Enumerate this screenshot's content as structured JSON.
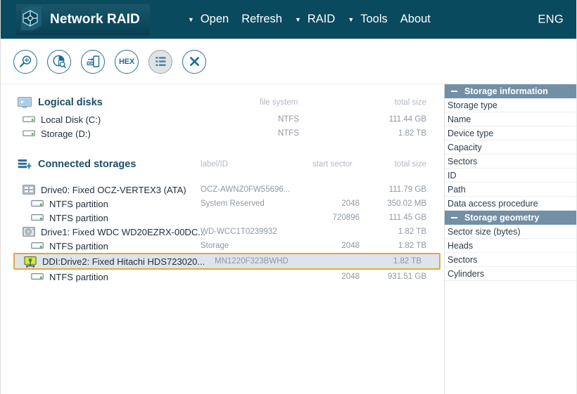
{
  "window": {
    "brand_title": "Network RAID",
    "logo_icon": "network-raid-hex-logo-icon",
    "language": "ENG"
  },
  "menu": {
    "items": [
      {
        "label": "Open",
        "caret": true,
        "caret_glyph": "▼"
      },
      {
        "label": "Refresh",
        "caret": false,
        "caret_glyph": ""
      },
      {
        "label": "RAID",
        "caret": true,
        "caret_glyph": "▼"
      },
      {
        "label": "Tools",
        "caret": true,
        "caret_glyph": "▼"
      },
      {
        "label": "About",
        "caret": false,
        "caret_glyph": ""
      }
    ]
  },
  "toolbar": {
    "buttons": [
      {
        "name": "scan-magnifier-icon",
        "kind": "magnifier",
        "label": "",
        "active": false
      },
      {
        "name": "disk-analysis-icon",
        "kind": "piechart",
        "label": "",
        "active": false
      },
      {
        "name": "copy-disk-icon",
        "kind": "copydisk",
        "label": "",
        "active": false
      },
      {
        "name": "hex-viewer-icon",
        "kind": "text",
        "label": "HEX",
        "active": false
      },
      {
        "name": "list-view-icon",
        "kind": "list",
        "label": "",
        "active": true
      },
      {
        "name": "close-icon",
        "kind": "close",
        "label": "",
        "active": false
      }
    ]
  },
  "tree": {
    "logical_disks": {
      "title": "Logical disks",
      "icon": "monitor-icon",
      "columns": {
        "file_system": "file system",
        "total_size": "total size"
      },
      "rows": [
        {
          "icon": "drive-icon",
          "name": "Local Disk (C:)",
          "file_system": "NTFS",
          "total_size": "111.44 GB"
        },
        {
          "icon": "drive-icon",
          "name": "Storage (D:)",
          "file_system": "NTFS",
          "total_size": "1.82 TB"
        }
      ]
    },
    "connected_storages": {
      "title": "Connected storages",
      "icon": "storages-icon",
      "columns": {
        "label_id": "label/ID",
        "start_sector": "start sector",
        "total_size": "total size"
      },
      "rows": [
        {
          "icon": "ssd-icon",
          "level": 1,
          "selected": false,
          "name": "Drive0: Fixed OCZ-VERTEX3 (ATA)",
          "label_id": "OCZ-AWNZ0FW55696...",
          "start_sector": "",
          "total_size": "111.79 GB"
        },
        {
          "icon": "partition-icon",
          "level": 2,
          "selected": false,
          "name": "NTFS partition",
          "label_id": "System Reserved",
          "start_sector": "2048",
          "total_size": "350.02 MB"
        },
        {
          "icon": "partition-icon",
          "level": 2,
          "selected": false,
          "name": "NTFS partition",
          "label_id": "",
          "start_sector": "720896",
          "total_size": "111.45 GB"
        },
        {
          "icon": "hdd-icon",
          "level": 1,
          "selected": false,
          "name": "Drive1: Fixed WDC WD20EZRX-00DC...",
          "label_id": "WD-WCC1T0239932",
          "start_sector": "",
          "total_size": "1.82 TB"
        },
        {
          "icon": "partition-icon",
          "level": 2,
          "selected": false,
          "name": "NTFS partition",
          "label_id": "Storage",
          "start_sector": "2048",
          "total_size": "1.82 TB"
        },
        {
          "icon": "network-drive-icon",
          "level": 1,
          "selected": true,
          "name": "DDI:Drive2: Fixed Hitachi HDS723020...",
          "label_id": "MN1220F323BWHD",
          "start_sector": "",
          "total_size": "1.82 TB"
        },
        {
          "icon": "partition-icon",
          "level": 2,
          "selected": false,
          "name": "NTFS partition",
          "label_id": "",
          "start_sector": "2048",
          "total_size": "931.51 GB"
        }
      ]
    }
  },
  "side_panel": {
    "sections": [
      {
        "title": "Storage information",
        "collapse_icon": "minus-icon",
        "rows": [
          {
            "label": "Storage type",
            "value": ""
          },
          {
            "label": "Name",
            "value": ""
          },
          {
            "label": "Device type",
            "value": ""
          },
          {
            "label": "Capacity",
            "value": ""
          },
          {
            "label": "Sectors",
            "value": ""
          },
          {
            "label": "ID",
            "value": ""
          },
          {
            "label": "Path",
            "value": ""
          },
          {
            "label": "Data access procedure",
            "value": ""
          }
        ]
      },
      {
        "title": "Storage geometry",
        "collapse_icon": "minus-icon",
        "rows": [
          {
            "label": "Sector size (bytes)",
            "value": ""
          },
          {
            "label": "Heads",
            "value": ""
          },
          {
            "label": "Sectors",
            "value": ""
          },
          {
            "label": "Cylinders",
            "value": ""
          }
        ]
      }
    ]
  },
  "colors": {
    "header_bg": "#0a4a5f",
    "accent_blue": "#2a6f96",
    "section_head_bg": "#738fa6",
    "selection_bg": "#dde4ec",
    "selection_border": "#e0a93c"
  }
}
